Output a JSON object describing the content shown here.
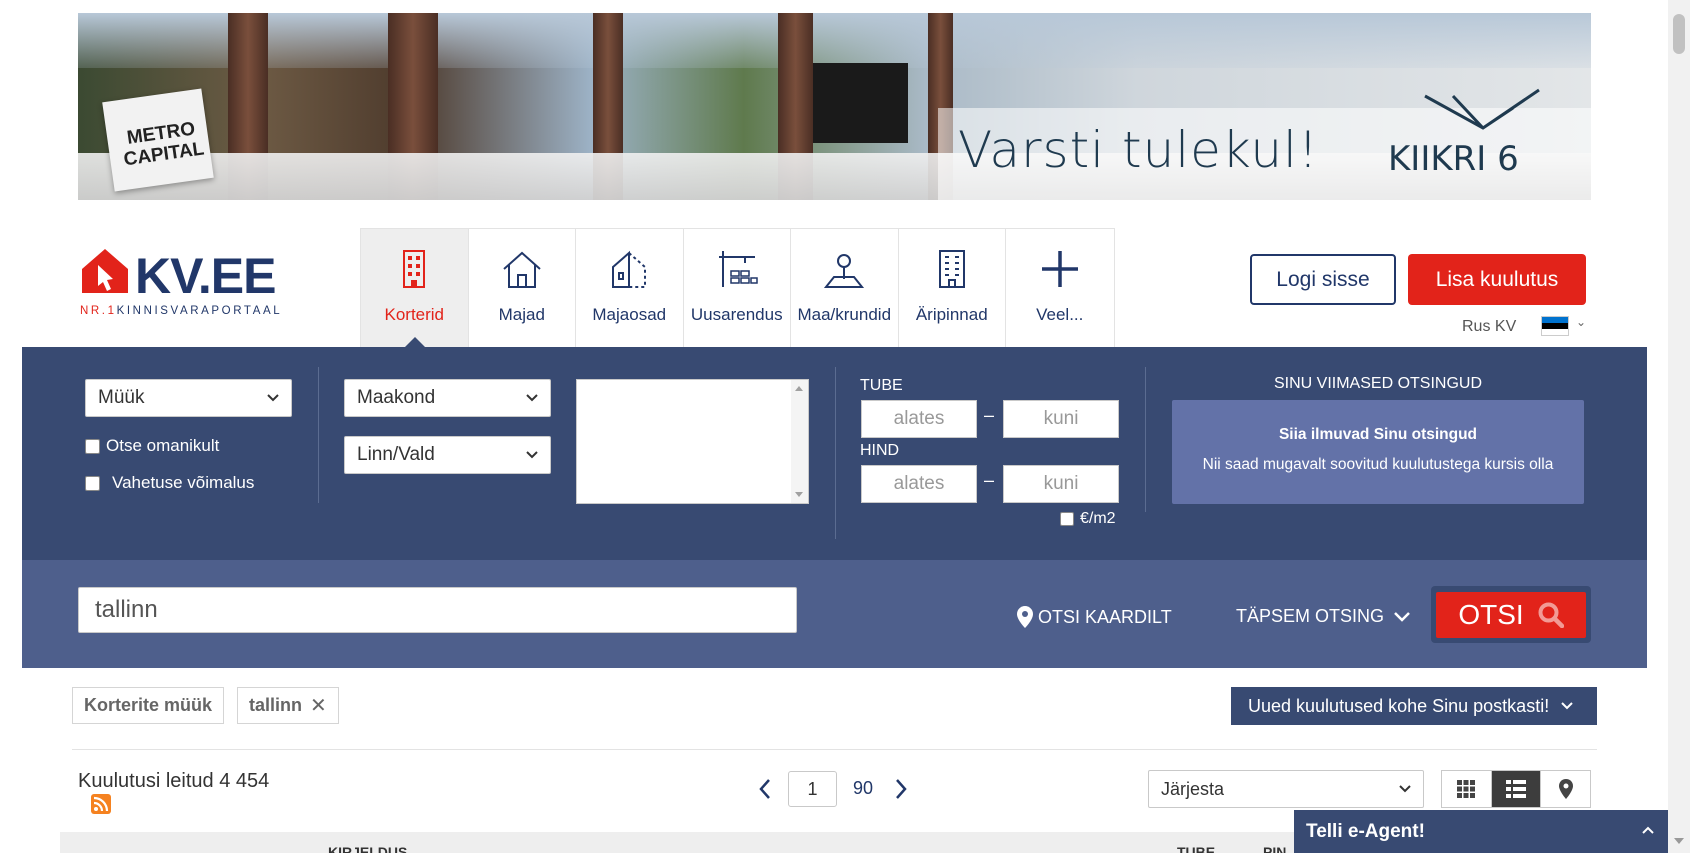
{
  "banner": {
    "headline": "Varsti tulekul!",
    "project": "KIIKRI 6",
    "developer": "METRO CAPITAL"
  },
  "logo": {
    "name": "KV.EE",
    "tag_prefix": "NR.1",
    "tagline": "KINNISVARAPORTAAL"
  },
  "nav": [
    {
      "label": "Korterid",
      "icon": "apartment-building-icon",
      "active": true
    },
    {
      "label": "Majad",
      "icon": "house-icon"
    },
    {
      "label": "Majaosad",
      "icon": "house-part-icon"
    },
    {
      "label": "Uusarendus",
      "icon": "new-development-icon"
    },
    {
      "label": "Maa/krundid",
      "icon": "land-plot-icon"
    },
    {
      "label": "Äripinnad",
      "icon": "office-building-icon"
    },
    {
      "label": "Veel...",
      "icon": "plus-icon"
    }
  ],
  "header": {
    "login": "Logi sisse",
    "add_listing": "Lisa kuulutus",
    "language": "Rus KV"
  },
  "colors": {
    "brand_blue": "#213769",
    "accent_red": "#e2231a",
    "panel": "#384a72",
    "panel_light": "#4e5f8c"
  },
  "filters": {
    "deal_type": "Müük",
    "owner_only": "Otse omanikult",
    "exchange": "Vahetuse võimalus",
    "county": "Maakond",
    "city": "Linn/Vald",
    "rooms_label": "TUBE",
    "price_label": "HIND",
    "from_placeholder": "alates",
    "to_placeholder": "kuni",
    "range_separator": "–",
    "per_m2": "€/m2"
  },
  "recent": {
    "title": "SINU VIIMASED OTSINGUD",
    "empty_title": "Siia ilmuvad Sinu otsingud",
    "empty_text": "Nii saad mugavalt soovitud kuulutustega kursis olla"
  },
  "search": {
    "keyword": "tallinn",
    "map_link": "OTSI KAARDILT",
    "advanced": "TÄPSEM OTSING",
    "submit": "OTSI"
  },
  "active_filters": [
    {
      "label": "Korterite müük"
    },
    {
      "label": "tallinn",
      "removable": "✕"
    }
  ],
  "subscribe": "Uued kuulutused kohe Sinu postkasti!",
  "results": {
    "label": "Kuulutusi leitud 4 454"
  },
  "pagination": {
    "current": "1",
    "total": "90"
  },
  "sort": {
    "placeholder": "Järjesta"
  },
  "table": {
    "col_description": "KIRJELDUS",
    "col_rooms": "TUBE",
    "col_area": "PIN"
  },
  "eagent": "Telli e-Agent!"
}
